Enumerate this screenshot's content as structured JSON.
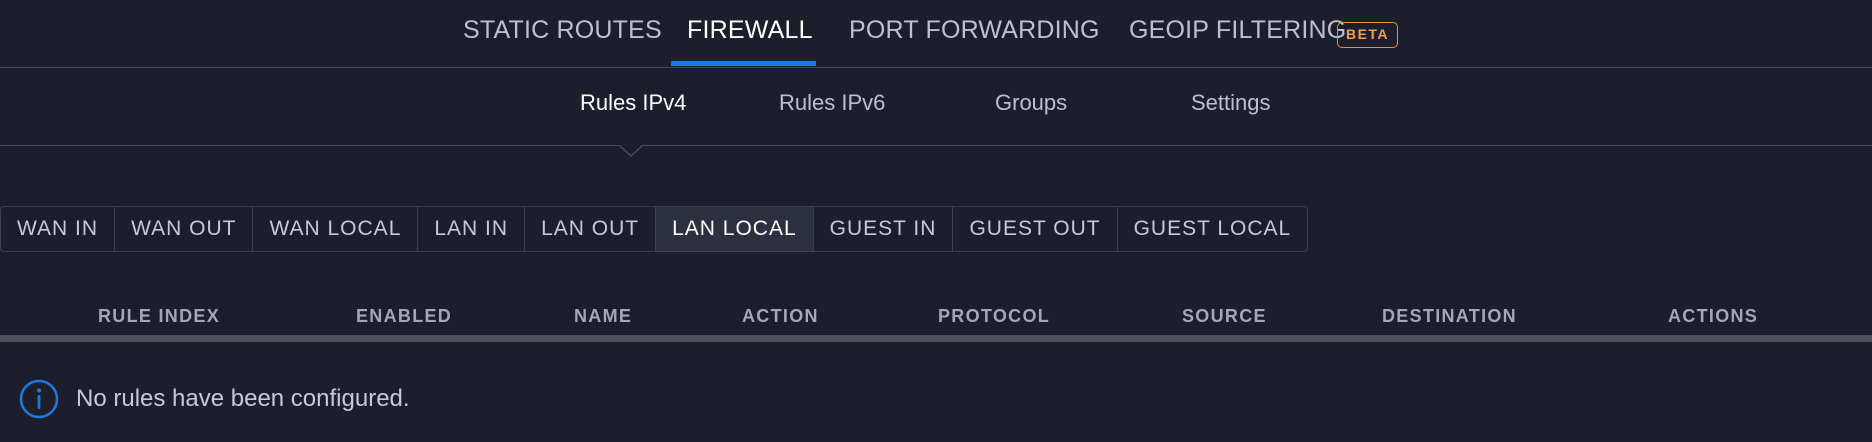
{
  "top_tabs": {
    "static_routes": "STATIC ROUTES",
    "firewall": "FIREWALL",
    "port_forwarding": "PORT FORWARDING",
    "geoip_filtering": "GEOIP FILTERING",
    "beta_badge": "BETA",
    "active": "FIREWALL",
    "accent_color": "#1f7ae0",
    "badge_color": "#e0953a"
  },
  "sub_tabs": {
    "rules_ipv4": "Rules IPv4",
    "rules_ipv6": "Rules IPv6",
    "groups": "Groups",
    "settings": "Settings",
    "active": "Rules IPv4"
  },
  "chain_tabs": {
    "items": [
      "WAN IN",
      "WAN OUT",
      "WAN LOCAL",
      "LAN IN",
      "LAN OUT",
      "LAN LOCAL",
      "GUEST IN",
      "GUEST OUT",
      "GUEST LOCAL"
    ],
    "active": "LAN LOCAL"
  },
  "table": {
    "columns": [
      "RULE INDEX",
      "ENABLED",
      "NAME",
      "ACTION",
      "PROTOCOL",
      "SOURCE",
      "DESTINATION",
      "ACTIONS"
    ],
    "rows": []
  },
  "empty_state": {
    "icon": "info-icon",
    "message": "No rules have been configured."
  }
}
